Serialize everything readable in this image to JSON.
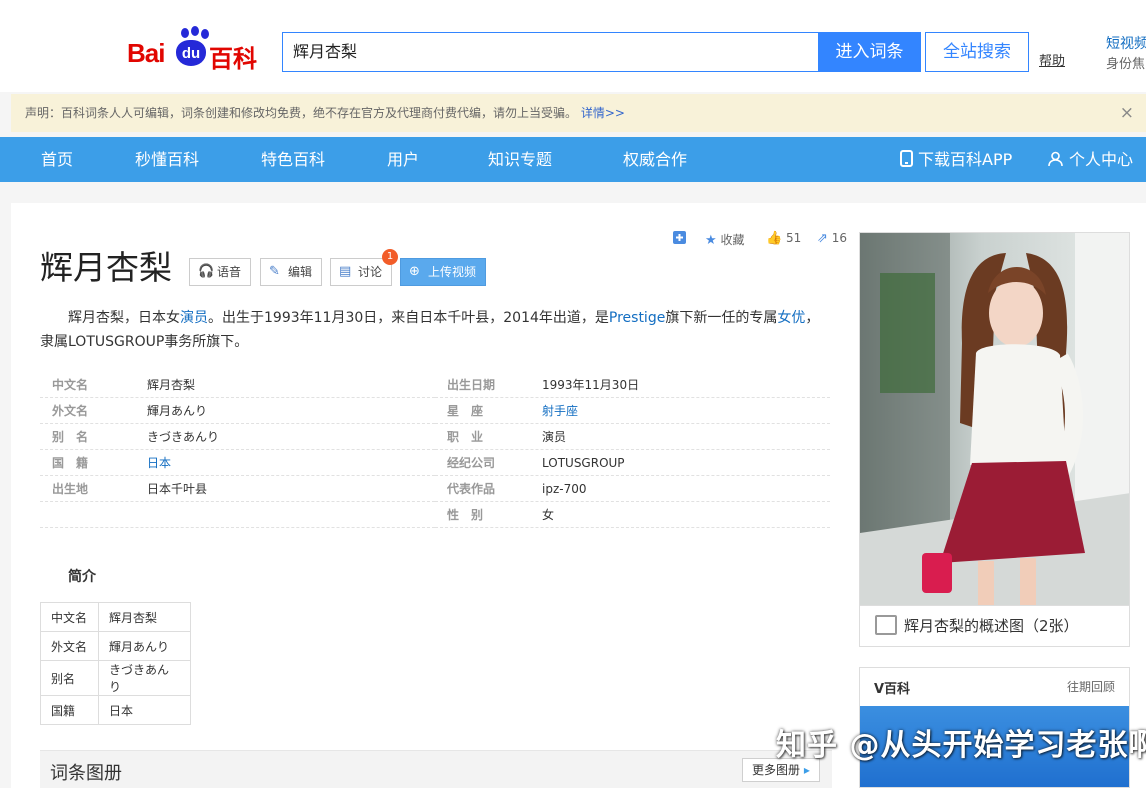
{
  "header": {
    "logo_text_1": "Bai",
    "logo_text_2": "du",
    "logo_text_3": "百科",
    "search_value": "辉月杏梨",
    "enter_button": "进入词条",
    "search_all_button": "全站搜索",
    "help_link": "帮助",
    "video_link": "短视频",
    "video_sub": "身份焦"
  },
  "notice": {
    "text": "声明：百科词条人人可编辑，词条创建和修改均免费，绝不存在官方及代理商付费代编，请勿上当受骗。",
    "detail_link": "详情>>",
    "close": "×"
  },
  "nav": {
    "items": [
      "首页",
      "秒懂百科",
      "特色百科",
      "用户",
      "知识专题",
      "权威合作"
    ],
    "app_download": "下载百科APP",
    "personal_center": "个人中心"
  },
  "entry": {
    "title": "辉月杏梨",
    "toolbar": {
      "voice": "语音",
      "edit": "编辑",
      "discuss": "讨论",
      "discuss_badge": "1",
      "upload_video": "上传视频"
    },
    "share": {
      "favorite": "收藏",
      "likes": "51",
      "shares": "16"
    },
    "summary_parts": [
      "辉月杏梨，日本女",
      "演员",
      "。出生于1993年11月30日，来自日本千叶县，2014年出道，是",
      "Prestige",
      "旗下新一任的专属",
      "女优",
      "，隶属LOTUSGROUP事务所旗下。"
    ],
    "info_left": [
      {
        "key": "中文名",
        "value": "辉月杏梨"
      },
      {
        "key": "外文名",
        "value": "輝月あんり"
      },
      {
        "key": "别　名",
        "value": "きづきあんり"
      },
      {
        "key": "国　籍",
        "value": "日本"
      },
      {
        "key": "出生地",
        "value": "日本千叶县"
      }
    ],
    "info_right": [
      {
        "key": "出生日期",
        "value": "1993年11月30日"
      },
      {
        "key": "星　座",
        "value": "射手座"
      },
      {
        "key": "职　业",
        "value": "演员"
      },
      {
        "key": "经纪公司",
        "value": "LOTUSGROUP"
      },
      {
        "key": "代表作品",
        "value": "ipz-700"
      },
      {
        "key": "性　别",
        "value": "女"
      }
    ],
    "intro_title": "简介",
    "intro_table": [
      {
        "key": "中文名",
        "value": "辉月杏梨"
      },
      {
        "key": "外文名",
        "value": "輝月あんり"
      },
      {
        "key": "别名",
        "value": "きづきあんり"
      },
      {
        "key": "国籍",
        "value": "日本"
      }
    ],
    "album_title": "词条图册",
    "album_more": "更多图册"
  },
  "sidebar": {
    "photo_caption": "辉月杏梨的概述图（2张）",
    "vbaike_title": "V百科",
    "vbaike_more": "往期回顾"
  },
  "watermark": "知乎 @从头开始学习老张啊",
  "colors": {
    "nav_bg": "#3c9ee8",
    "brand_red": "#e10601",
    "brand_blue": "#2529d8",
    "link": "#136ec2",
    "notice_bg": "#f8f2d9"
  }
}
